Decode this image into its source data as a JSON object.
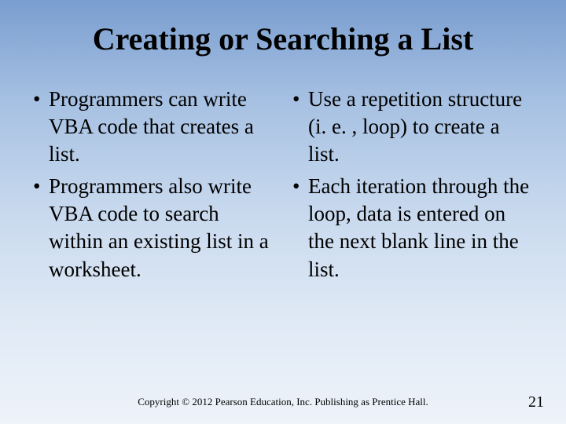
{
  "title": "Creating or Searching a List",
  "left": {
    "items": [
      "Programmers can write VBA code that creates a list.",
      "Programmers also write VBA code to search within an existing list in a worksheet."
    ]
  },
  "right": {
    "items": [
      "Use a repetition structure (i. e. , loop) to create a list.",
      "Each iteration through the loop, data is entered on the next blank line in the list."
    ]
  },
  "footer": "Copyright © 2012 Pearson Education, Inc. Publishing as Prentice Hall.",
  "page": "21",
  "bullet_char": "•"
}
